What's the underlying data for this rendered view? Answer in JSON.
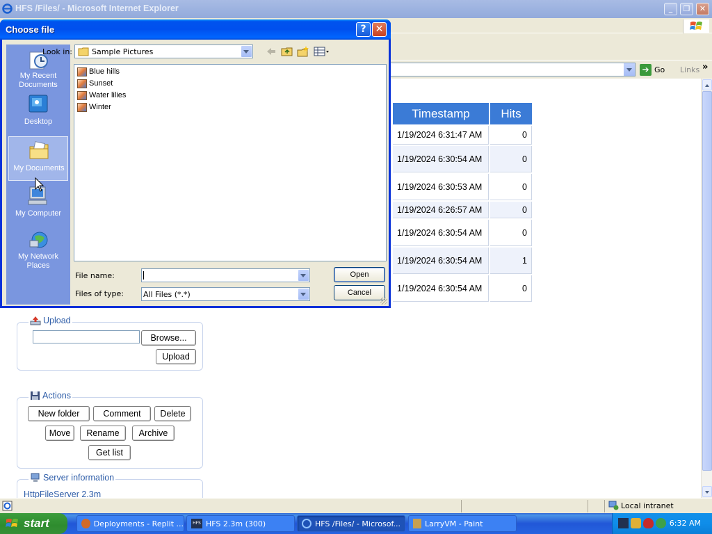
{
  "browser": {
    "title": "HFS /Files/ - Microsoft Internet Explorer",
    "go_label": "Go",
    "links_label": "Links",
    "status_zone": "Local intranet"
  },
  "dialog": {
    "title": "Choose file",
    "look_in_label": "Look in:",
    "look_in_value": "Sample Pictures",
    "places": [
      {
        "label": "My Recent Documents",
        "icon": "recent-documents-icon"
      },
      {
        "label": "Desktop",
        "icon": "desktop-icon"
      },
      {
        "label": "My Documents",
        "icon": "my-documents-icon",
        "selected": true
      },
      {
        "label": "My Computer",
        "icon": "my-computer-icon"
      },
      {
        "label": "My Network Places",
        "icon": "network-places-icon"
      }
    ],
    "files": [
      "Blue hills",
      "Sunset",
      "Water lilies",
      "Winter"
    ],
    "file_name_label": "File name:",
    "file_name_value": "",
    "files_of_type_label": "Files of type:",
    "files_of_type_value": "All Files (*.*)",
    "open_label": "Open",
    "cancel_label": "Cancel"
  },
  "table": {
    "headers": {
      "timestamp": "Timestamp",
      "hits": "Hits"
    },
    "rows": [
      {
        "timestamp": "1/19/2024 6:31:47 AM",
        "hits": "0"
      },
      {
        "timestamp": "1/19/2024 6:30:54 AM",
        "hits": "0"
      },
      {
        "timestamp": "1/19/2024 6:30:53 AM",
        "hits": "0"
      },
      {
        "timestamp": "1/19/2024 6:26:57 AM",
        "hits": "0"
      },
      {
        "timestamp": "1/19/2024 6:30:54 AM",
        "hits": "0"
      },
      {
        "timestamp": "1/19/2024 6:30:54 AM",
        "hits": "1"
      },
      {
        "timestamp": "1/19/2024 6:30:54 AM",
        "hits": "0"
      }
    ]
  },
  "upload": {
    "legend": "Upload",
    "browse_label": "Browse...",
    "upload_label": "Upload"
  },
  "actions": {
    "legend": "Actions",
    "new_folder": "New folder",
    "comment": "Comment",
    "delete": "Delete",
    "move": "Move",
    "rename": "Rename",
    "archive": "Archive",
    "get_list": "Get list"
  },
  "server_info": {
    "legend": "Server information",
    "version": "HttpFileServer 2.3m"
  },
  "taskbar": {
    "start_label": "start",
    "items": [
      {
        "label": "Deployments - Replit ...",
        "active": false
      },
      {
        "label": "HFS 2.3m (300)",
        "active": false
      },
      {
        "label": "HFS /Files/ - Microsof...",
        "active": true
      },
      {
        "label": "LarryVM - Paint",
        "active": false
      }
    ],
    "clock": "6:32 AM"
  }
}
